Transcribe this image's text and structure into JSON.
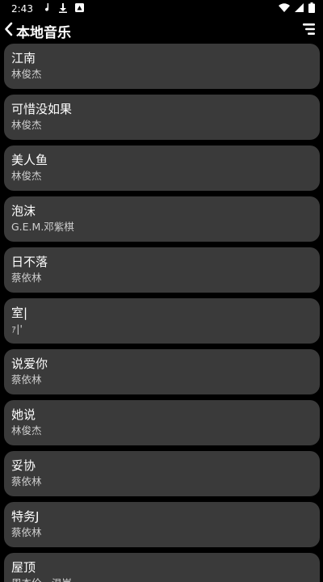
{
  "status_bar": {
    "time": "2:43"
  },
  "header": {
    "title": "本地音乐"
  },
  "songs": [
    {
      "title": "江南",
      "artist": "林俊杰"
    },
    {
      "title": "可惜没如果",
      "artist": "林俊杰"
    },
    {
      "title": "美人鱼",
      "artist": "林俊杰"
    },
    {
      "title": "泡沫",
      "artist": "G.E.M.邓紫棋"
    },
    {
      "title": "日不落",
      "artist": "蔡依林"
    },
    {
      "title": "室|",
      "artist": "ｧ|'"
    },
    {
      "title": "说爱你",
      "artist": "蔡依林"
    },
    {
      "title": "她说",
      "artist": "林俊杰"
    },
    {
      "title": "妥协",
      "artist": "蔡依林"
    },
    {
      "title": "特务J",
      "artist": "蔡依林"
    },
    {
      "title": "屋顶",
      "artist": "周杰伦、温岚"
    }
  ]
}
